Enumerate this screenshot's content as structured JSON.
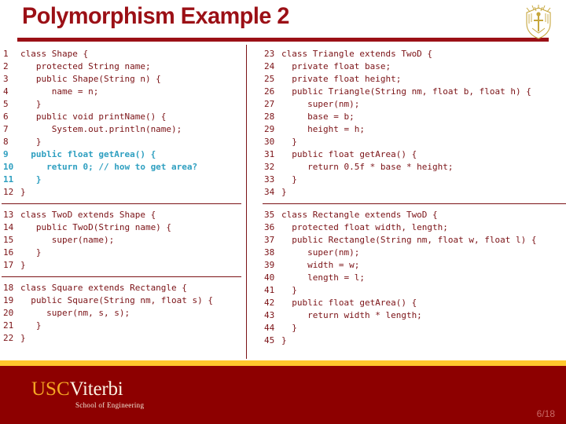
{
  "header": {
    "title": "Polymorphism Example 2",
    "title_color": "#9B1016",
    "rule_color": "#9B1016",
    "crest_icon": "usc-shield-crest-icon"
  },
  "theme": {
    "code_color": "#7B1216",
    "highlight_color": "#2E9FC0",
    "gold": "#FFC72C",
    "footer_red": "#8D0000",
    "page_number_color": "#C96A66"
  },
  "code": {
    "left_column": [
      {
        "block_id": "shape-class",
        "lines": [
          {
            "n": "1",
            "text": "class Shape {",
            "hl": false
          },
          {
            "n": "2",
            "text": "   protected String name;",
            "hl": false
          },
          {
            "n": "3",
            "text": "   public Shape(String n) {",
            "hl": false
          },
          {
            "n": "4",
            "text": "      name = n;",
            "hl": false
          },
          {
            "n": "5",
            "text": "   }",
            "hl": false
          },
          {
            "n": "6",
            "text": "   public void printName() {",
            "hl": false
          },
          {
            "n": "7",
            "text": "      System.out.println(name);",
            "hl": false
          },
          {
            "n": "8",
            "text": "   }",
            "hl": false
          },
          {
            "n": "9",
            "text": "  public float getArea() {",
            "hl": true
          },
          {
            "n": "10",
            "text": "     return 0; // how to get area?",
            "hl": true
          },
          {
            "n": "11",
            "text": "   }",
            "hl": true
          },
          {
            "n": "12",
            "text": "}",
            "hl": false
          }
        ]
      },
      {
        "block_id": "twod-class",
        "lines": [
          {
            "n": "13",
            "text": "class TwoD extends Shape {",
            "hl": false
          },
          {
            "n": "14",
            "text": "   public TwoD(String name) {",
            "hl": false
          },
          {
            "n": "15",
            "text": "      super(name);",
            "hl": false
          },
          {
            "n": "16",
            "text": "   }",
            "hl": false
          },
          {
            "n": "17",
            "text": "}",
            "hl": false
          }
        ]
      },
      {
        "block_id": "square-class",
        "lines": [
          {
            "n": "18",
            "text": "class Square extends Rectangle {",
            "hl": false
          },
          {
            "n": "19",
            "text": "  public Square(String nm, float s) {",
            "hl": false
          },
          {
            "n": "20",
            "text": "     super(nm, s, s);",
            "hl": false
          },
          {
            "n": "21",
            "text": "   }",
            "hl": false
          },
          {
            "n": "22",
            "text": "}",
            "hl": false
          }
        ]
      }
    ],
    "right_column": [
      {
        "block_id": "triangle-class",
        "lines": [
          {
            "n": "23",
            "text": "class Triangle extends TwoD {",
            "hl": false
          },
          {
            "n": "24",
            "text": "  private float base;",
            "hl": false
          },
          {
            "n": "25",
            "text": "  private float height;",
            "hl": false
          },
          {
            "n": "26",
            "text": "  public Triangle(String nm, float b, float h) {",
            "hl": false
          },
          {
            "n": "27",
            "text": "     super(nm);",
            "hl": false
          },
          {
            "n": "28",
            "text": "     base = b;",
            "hl": false
          },
          {
            "n": "29",
            "text": "     height = h;",
            "hl": false
          },
          {
            "n": "30",
            "text": "  }",
            "hl": false
          },
          {
            "n": "31",
            "text": "  public float getArea() {",
            "hl": false
          },
          {
            "n": "32",
            "text": "     return 0.5f * base * height;",
            "hl": false
          },
          {
            "n": "33",
            "text": "  }",
            "hl": false
          },
          {
            "n": "34",
            "text": "}",
            "hl": false
          }
        ]
      },
      {
        "block_id": "rectangle-class",
        "lines": [
          {
            "n": "35",
            "text": "class Rectangle extends TwoD {",
            "hl": false
          },
          {
            "n": "36",
            "text": "  protected float width, length;",
            "hl": false
          },
          {
            "n": "37",
            "text": "  public Rectangle(String nm, float w, float l) {",
            "hl": false
          },
          {
            "n": "38",
            "text": "     super(nm);",
            "hl": false
          },
          {
            "n": "39",
            "text": "     width = w;",
            "hl": false
          },
          {
            "n": "40",
            "text": "     length = l;",
            "hl": false
          },
          {
            "n": "41",
            "text": "  }",
            "hl": false
          },
          {
            "n": "42",
            "text": "  public float getArea() {",
            "hl": false
          },
          {
            "n": "43",
            "text": "     return width * length;",
            "hl": false
          },
          {
            "n": "44",
            "text": "  }",
            "hl": false
          },
          {
            "n": "45",
            "text": "}",
            "hl": false
          }
        ]
      }
    ]
  },
  "footer": {
    "logo_usc": "USC",
    "logo_viterbi": "Viterbi",
    "logo_subtitle": "School of Engineering",
    "page_number": "6/18"
  }
}
